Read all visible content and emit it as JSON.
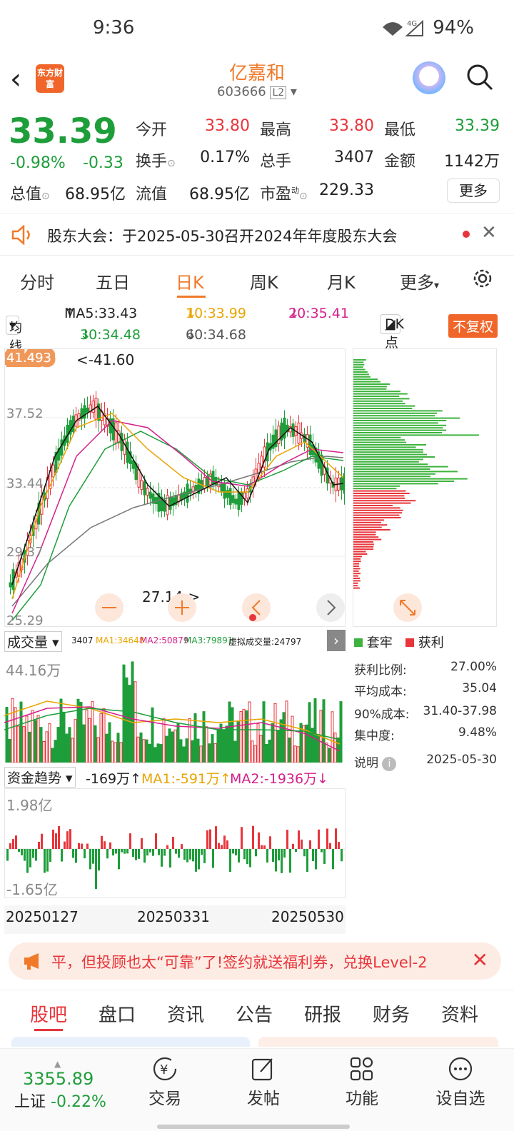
{
  "status": {
    "time": "9:36",
    "battery": "94%",
    "net": "4G"
  },
  "header": {
    "logo": "东方财富",
    "name": "亿嘉和",
    "code": "603666",
    "level": "L2"
  },
  "quote": {
    "price": "33.39",
    "pct": "-0.98%",
    "chg": "-0.33",
    "open_label": "今开",
    "open": "33.80",
    "high_label": "最高",
    "high": "33.80",
    "low_label": "最低",
    "low": "33.39",
    "turn_label": "换手",
    "turn": "0.17%",
    "hands_label": "总手",
    "hands": "3407",
    "amt_label": "金额",
    "amt": "1142万",
    "tv_label": "总值",
    "tv": "68.95亿",
    "fv_label": "流值",
    "fv": "68.95亿",
    "pe_label": "市盈",
    "pe_sup": "动",
    "pe": "229.33",
    "more": "更多"
  },
  "notice": {
    "text": "股东大会：于2025-05-30召开2024年年度股东大会",
    "close": "✕"
  },
  "tabs": [
    "分时",
    "五日",
    "日K",
    "周K",
    "月K",
    "更多"
  ],
  "ma": {
    "junxian": "均线",
    "ma5": "MA5:33.43",
    "ma10": "10:33.99",
    "ma20": "20:35.41",
    "ma30": "30:34.48",
    "ma60": "60:34.68",
    "dk": "DK点",
    "fuq": "不复权"
  },
  "kchart": {
    "top": "41.493",
    "p1": "37.52",
    "p2": "33.44",
    "p3": "29.37",
    "bot": "25.29",
    "hi": "<-41.60",
    "lo": "27.14->"
  },
  "volume": {
    "label": "成交量",
    "v": "3407",
    "ma1": "MA1:34648",
    "ma2": "MA2:50879",
    "ma3": "MA3:79891",
    "virt": "虚拟成交量:24797",
    "max": "44.16万"
  },
  "fund": {
    "label": "资金趋势",
    "v": "-169万",
    "ma1": "MA1:-591万",
    "ma2": "MA2:-1936万",
    "max": "1.98亿",
    "min": "-1.65亿"
  },
  "dates": [
    "20250127",
    "20250331",
    "20250530"
  ],
  "chip": {
    "legend1": "套牢",
    "legend2": "获利",
    "rows": [
      {
        "label": "获利比例:",
        "value": "27.00%"
      },
      {
        "label": "平均成本:",
        "value": "35.04"
      },
      {
        "label": "90%成本:",
        "value": "31.40-37.98"
      },
      {
        "label": "集中度:",
        "value": "9.48%"
      }
    ],
    "note": "说明",
    "date": "2025-05-30"
  },
  "ad": {
    "text": "平，但投顾也太“可靠”了!签约就送福利券，兑换Level-2"
  },
  "btabs": [
    "股吧",
    "盘口",
    "资讯",
    "公告",
    "研报",
    "财务",
    "资料"
  ],
  "bottom": {
    "index_val": "3355.89",
    "index_name": "上证",
    "index_pct": "-0.22%",
    "items": [
      "交易",
      "发帖",
      "功能",
      "设自选"
    ]
  },
  "colors": {
    "up": "#e8353b",
    "down": "#1e9e3a",
    "accent": "#f07a2a"
  }
}
